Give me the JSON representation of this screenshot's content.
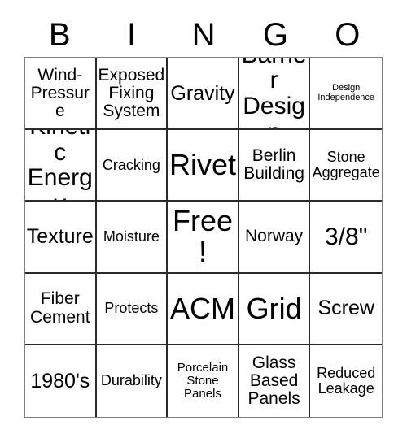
{
  "card": {
    "header_letters": [
      "B",
      "I",
      "N",
      "G",
      "O"
    ],
    "columns": 5,
    "rows": 5,
    "colors": {
      "background": "#ffffff",
      "text": "#000000",
      "cell_border": "#2b2b2b",
      "outer_border": "#808080"
    },
    "cells": [
      {
        "text": "Wind-Pressure",
        "size": "fs-md"
      },
      {
        "text": "Exposed Fixing System",
        "size": "fs-md"
      },
      {
        "text": "Gravity",
        "size": "fs-lg"
      },
      {
        "text": "Barrier Design",
        "size": "fs-xl"
      },
      {
        "text": "Design Independence",
        "size": "fs-xxs"
      },
      {
        "text": "Kinetic Energy",
        "size": "fs-xl"
      },
      {
        "text": "Cracking",
        "size": "fs-sm"
      },
      {
        "text": "Rivet",
        "size": "fs-xxl"
      },
      {
        "text": "Berlin Building",
        "size": "fs-md"
      },
      {
        "text": "Stone Aggregate",
        "size": "fs-sm"
      },
      {
        "text": "Texture",
        "size": "fs-lg"
      },
      {
        "text": "Moisture",
        "size": "fs-sm"
      },
      {
        "text": "Free!",
        "size": "fs-xxl"
      },
      {
        "text": "Norway",
        "size": "fs-md"
      },
      {
        "text": "3/8\"",
        "size": "fs-xl"
      },
      {
        "text": "Fiber Cement",
        "size": "fs-md"
      },
      {
        "text": "Protects",
        "size": "fs-sm"
      },
      {
        "text": "ACM",
        "size": "fs-xxl"
      },
      {
        "text": "Grid",
        "size": "fs-xxl"
      },
      {
        "text": "Screw",
        "size": "fs-lg"
      },
      {
        "text": "1980's",
        "size": "fs-lg"
      },
      {
        "text": "Durability",
        "size": "fs-sm"
      },
      {
        "text": "Porcelain Stone Panels",
        "size": "fs-xs"
      },
      {
        "text": "Glass Based Panels",
        "size": "fs-md"
      },
      {
        "text": "Reduced Leakage",
        "size": "fs-sm"
      }
    ]
  }
}
